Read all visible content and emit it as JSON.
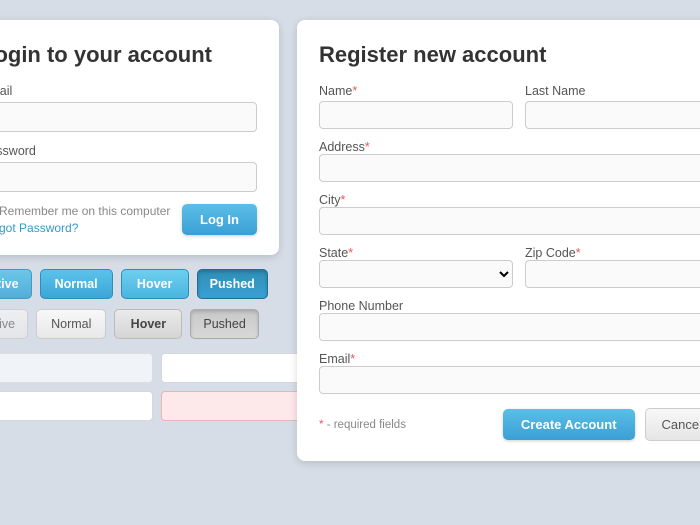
{
  "login": {
    "title": "Login to your account",
    "email_label": "Email",
    "email_placeholder": "",
    "password_label": "Password",
    "password_placeholder": "",
    "remember_label": "Remember me on this computer",
    "forgot_label": "Forgot Password?",
    "login_btn": "Log In"
  },
  "button_states": {
    "row1": {
      "inactive": "Inactive",
      "normal": "Normal",
      "hover": "Hover",
      "pushed": "Pushed"
    },
    "row2": {
      "inactive": "Inactive",
      "normal": "Normal",
      "hover": "Hover",
      "pushed": "Pushed"
    }
  },
  "register": {
    "title": "Register new account",
    "name_label": "Name",
    "name_required": "*",
    "lastname_label": "Last Name",
    "address_label": "Address",
    "address_required": "*",
    "city_label": "City",
    "city_required": "*",
    "state_label": "State",
    "state_required": "*",
    "zip_label": "Zip Code",
    "zip_required": "*",
    "phone_label": "Phone Number",
    "email_label": "Email",
    "email_required": "*",
    "required_note": "* - required fields",
    "create_btn": "Create Account",
    "cancel_btn": "Cancel"
  }
}
